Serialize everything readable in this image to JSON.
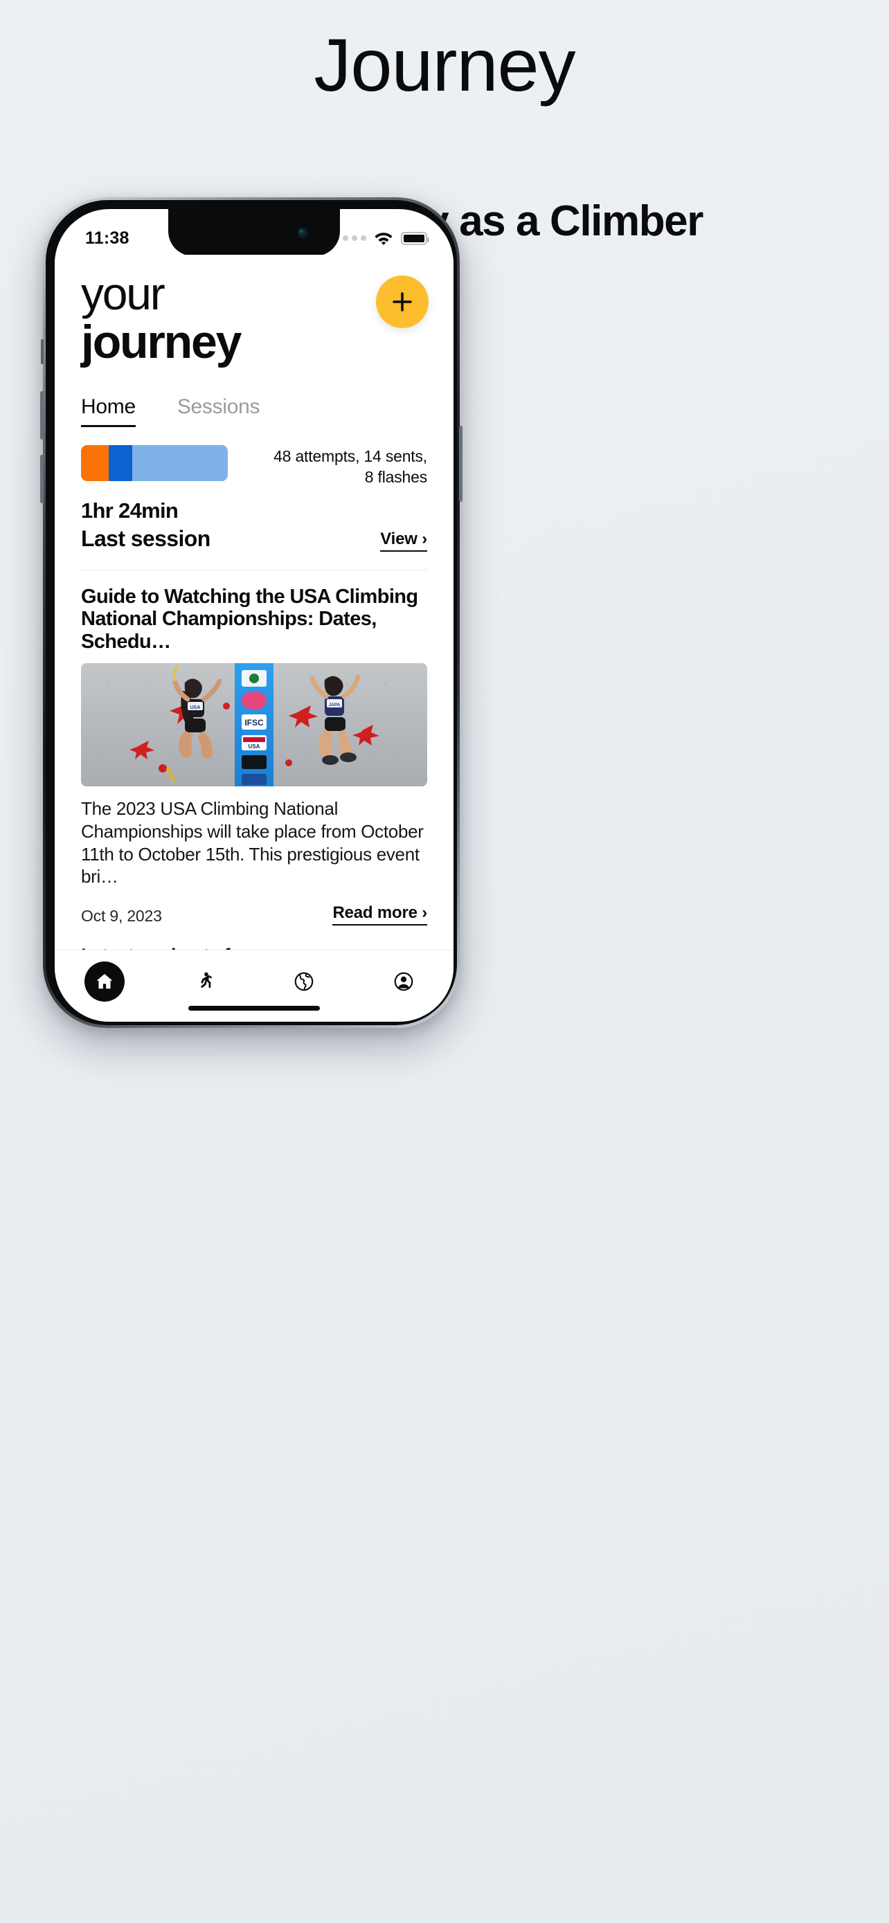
{
  "promo": {
    "title": "Journey",
    "subtitle": "Your Journey as a Climber"
  },
  "status_bar": {
    "time": "11:38",
    "signal_icon": "no-service-dots-icon",
    "wifi_icon": "wifi-icon",
    "battery_icon": "battery-full-icon"
  },
  "app": {
    "title_line1": "your",
    "title_line2": "journey",
    "add_button": "+",
    "tabs": [
      {
        "label": "Home",
        "active": true
      },
      {
        "label": "Sessions",
        "active": false
      }
    ],
    "session": {
      "stats_line1": "48 attempts, 14 sents,",
      "stats_line2": "8 flashes",
      "duration": "1hr 24min",
      "label": "Last session",
      "view_link": "View ›",
      "bar": {
        "attempts": 48,
        "sents": 14,
        "flashes": 8,
        "segment_colors": [
          "#f97306",
          "#0b62d0",
          "#7fb3e8"
        ],
        "segment_percents": [
          19,
          16,
          65
        ]
      }
    },
    "article": {
      "title": "Guide to Watching the USA Climbing National Championships: Dates, Schedu…",
      "image_alt": "two-climbers-on-competition-wall-photo",
      "body": "The 2023 USA Climbing National Championships will take place from October 11th to October 15th. This prestigious event bri…",
      "date": "Oct 9, 2023",
      "read_more": "Read more ›"
    },
    "workouts": {
      "heading": "Latest workouts for you"
    },
    "bottom_nav": [
      {
        "icon": "home-icon",
        "active": true
      },
      {
        "icon": "running-person-icon",
        "active": false
      },
      {
        "icon": "globe-icon",
        "active": false
      },
      {
        "icon": "profile-icon",
        "active": false
      }
    ]
  },
  "colors": {
    "background": "#eceff2",
    "accent_yellow": "#fcbe2d",
    "bar_orange": "#f97306",
    "bar_blue": "#0b62d0",
    "bar_light_blue": "#7fb3e8",
    "text": "#0b0b0c",
    "muted": "#9b9ba0"
  }
}
